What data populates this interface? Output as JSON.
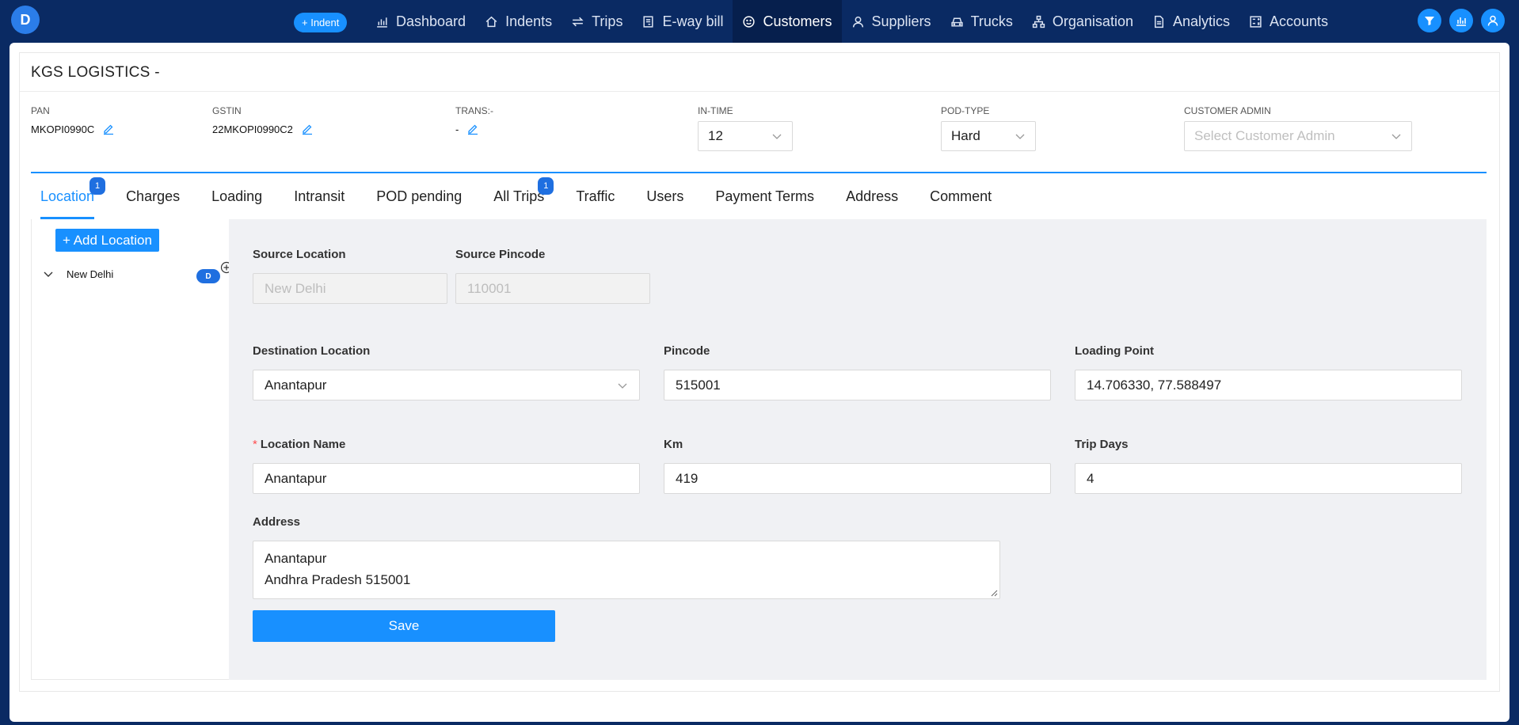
{
  "app": {
    "logo_letter": "D"
  },
  "nav": {
    "indent_button": "+ Indent",
    "items": [
      {
        "label": "Dashboard",
        "icon": "bar-chart-icon"
      },
      {
        "label": "Indents",
        "icon": "home-icon"
      },
      {
        "label": "Trips",
        "icon": "swap-icon"
      },
      {
        "label": "E-way bill",
        "icon": "receipt-icon"
      },
      {
        "label": "Customers",
        "icon": "smile-icon",
        "active": true
      },
      {
        "label": "Suppliers",
        "icon": "user-icon"
      },
      {
        "label": "Trucks",
        "icon": "car-icon"
      },
      {
        "label": "Organisation",
        "icon": "org-icon"
      },
      {
        "label": "Analytics",
        "icon": "file-icon"
      },
      {
        "label": "Accounts",
        "icon": "calculator-icon"
      }
    ],
    "right_icons": [
      "filter-icon",
      "chart-icon",
      "user-icon"
    ]
  },
  "customer": {
    "title": "KGS LOGISTICS -",
    "pan_label": "PAN",
    "pan_value": "MKOPI0990C",
    "gstin_label": "GSTIN",
    "gstin_value": "22MKOPI0990C2",
    "trans_label": "TRANS:-",
    "trans_value": "-",
    "in_time_label": "IN-TIME",
    "in_time_value": "12",
    "pod_type_label": "POD-TYPE",
    "pod_type_value": "Hard",
    "customer_admin_label": "CUSTOMER ADMIN",
    "customer_admin_placeholder": "Select Customer Admin"
  },
  "tabs": [
    {
      "label": "Location",
      "badge": "1",
      "active": true
    },
    {
      "label": "Charges"
    },
    {
      "label": "Loading"
    },
    {
      "label": "Intransit"
    },
    {
      "label": "POD pending"
    },
    {
      "label": "All Trips",
      "badge": "1"
    },
    {
      "label": "Traffic"
    },
    {
      "label": "Users"
    },
    {
      "label": "Payment Terms"
    },
    {
      "label": "Address"
    },
    {
      "label": "Comment"
    }
  ],
  "locations": {
    "add_button": "+ Add Location",
    "tree": [
      {
        "label": "New Delhi",
        "badge": "D"
      }
    ]
  },
  "form": {
    "source_location_label": "Source Location",
    "source_location_value": "New Delhi",
    "source_pincode_label": "Source Pincode",
    "source_pincode_value": "110001",
    "destination_location_label": "Destination Location",
    "destination_location_value": "Anantapur",
    "pincode_label": "Pincode",
    "pincode_value": "515001",
    "loading_point_label": "Loading Point",
    "loading_point_value": "14.706330, 77.588497",
    "required_mark": "*",
    "location_name_label": "Location Name",
    "location_name_value": "Anantapur",
    "km_label": "Km",
    "km_value": "419",
    "trip_days_label": "Trip Days",
    "trip_days_value": "4",
    "address_label": "Address",
    "address_line1": "Anantapur",
    "address_line2": "Andhra Pradesh 515001",
    "save_button": "Save"
  },
  "colors": {
    "nav_bg": "#0a2a63",
    "accent": "#1890ff",
    "badge": "#1f6fe0",
    "form_bg": "#f0f1f4"
  }
}
